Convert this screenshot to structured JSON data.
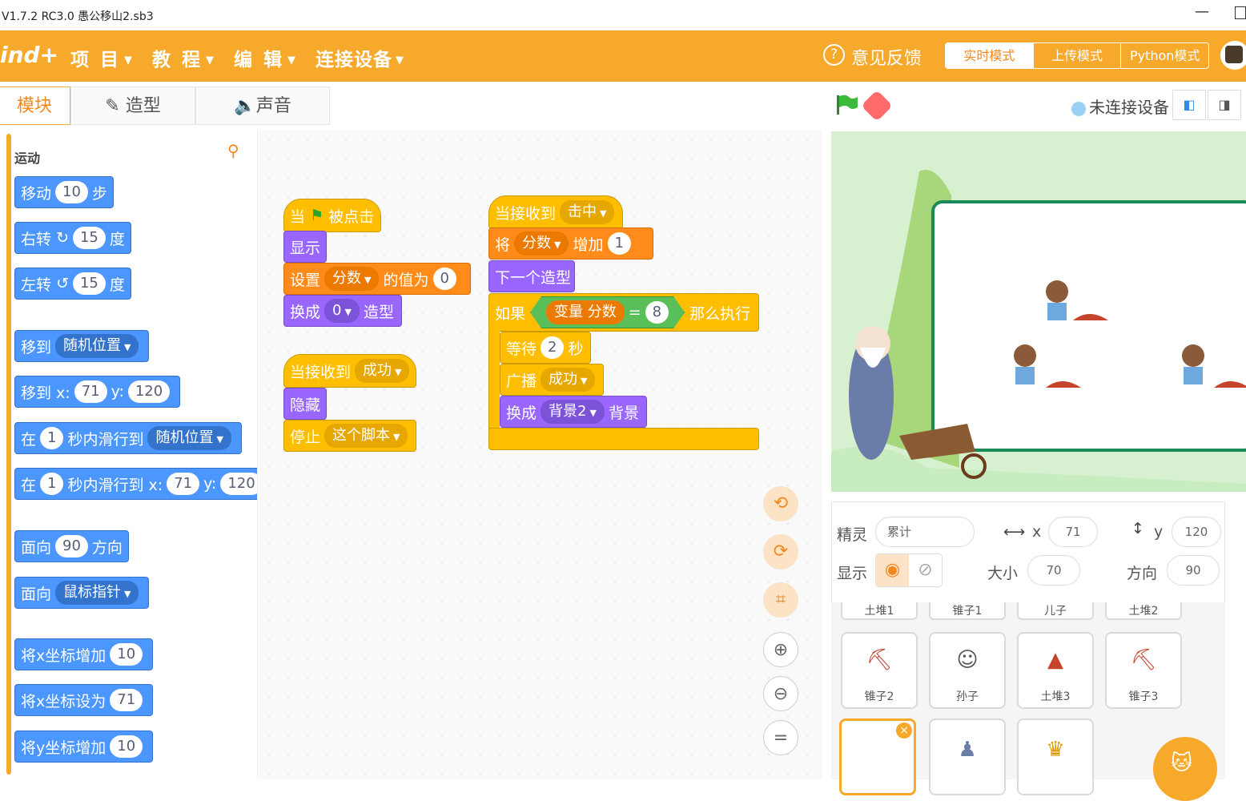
{
  "window": {
    "title": "V1.7.2 RC3.0   愚公移山2.sb3"
  },
  "menubar": {
    "logo": "ind+",
    "items": [
      "项 目",
      "教 程",
      "编 辑",
      "连接设备"
    ],
    "feedback": "意见反馈",
    "modes": [
      "实时模式",
      "上传模式",
      "Python模式"
    ]
  },
  "tabs": [
    "模块",
    "造型",
    "声音"
  ],
  "palette": {
    "category": "运动"
  },
  "blocks": {
    "move": [
      "移动",
      "10",
      "步"
    ],
    "turn_right": [
      "右转",
      "15",
      "度"
    ],
    "turn_left": [
      "左转",
      "15",
      "度"
    ],
    "goto": [
      "移到",
      "随机位置"
    ],
    "goto_xy": [
      "移到 x:",
      "71",
      "y:",
      "120"
    ],
    "glide": [
      "在",
      "1",
      "秒内滑行到",
      "随机位置"
    ],
    "glide_xy": [
      "在",
      "1",
      "秒内滑行到 x:",
      "71",
      "y:",
      "120"
    ],
    "point": [
      "面向",
      "90",
      "方向"
    ],
    "point_to": [
      "面向",
      "鼠标指针"
    ],
    "change_x": [
      "将x坐标增加",
      "10"
    ],
    "set_x": [
      "将x坐标设为",
      "71"
    ],
    "change_y": [
      "将y坐标增加",
      "10"
    ]
  },
  "scripts": {
    "s1": {
      "hat": [
        "当",
        "被点击"
      ],
      "show": "显示",
      "set": [
        "设置",
        "分数",
        "的值为",
        "0"
      ],
      "costume": [
        "换成",
        "0",
        "造型"
      ]
    },
    "s2": {
      "hat": [
        "当接收到",
        "成功"
      ],
      "hide": "隐藏",
      "stop": [
        "停止",
        "这个脚本"
      ]
    },
    "s3": {
      "hat": [
        "当接收到",
        "击中"
      ],
      "change": [
        "将",
        "分数",
        "增加",
        "1"
      ],
      "next": "下一个造型",
      "if": [
        "如果",
        "变量 分数",
        "=",
        "8",
        "那么执行"
      ],
      "wait": [
        "等待",
        "2",
        "秒"
      ],
      "broadcast": [
        "广播",
        "成功"
      ],
      "backdrop": [
        "换成",
        "背景2",
        "背景"
      ]
    }
  },
  "stage": {
    "connection": "未连接设备"
  },
  "props": {
    "sprite_label": "精灵",
    "sprite_name": "累计",
    "x_label": "x",
    "x": "71",
    "y_label": "y",
    "y": "120",
    "show_label": "显示",
    "size_label": "大小",
    "size": "70",
    "dir_label": "方向",
    "dir": "90"
  },
  "sprites": {
    "row0": [
      "土堆1",
      "锥子1",
      "儿子",
      "土堆2"
    ],
    "row1": [
      "锥子2",
      "孙子",
      "土堆3",
      "锥子3"
    ]
  }
}
